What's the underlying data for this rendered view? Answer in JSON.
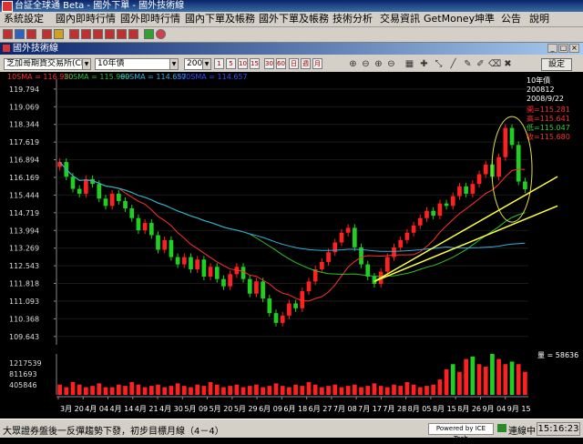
{
  "window": {
    "title": "台証全球通 Beta - 國外下單 - 國外技術線"
  },
  "menu": [
    "系統設定",
    "國內即時行情",
    "國外即時行情",
    "國內下單及帳務",
    "國外下單及帳務",
    "技術分析",
    "交易資訊",
    "GetMoney",
    "坤準",
    "公告",
    "說明"
  ],
  "inner_window": {
    "title": "國外技術線"
  },
  "chart_toolbar": {
    "exchange": "芝加哥期貨交易所(CME)",
    "product": "10年債",
    "period": "200812",
    "settings_label": "設定"
  },
  "chart_data": {
    "type": "candlestick",
    "title": "",
    "instrument": "10年債",
    "contract": "200812",
    "date": "2008/9/22",
    "ylim": [
      109.3,
      120.2
    ],
    "yticks": [
      119.794,
      119.069,
      118.344,
      117.619,
      116.894,
      116.169,
      115.444,
      114.719,
      113.994,
      113.269,
      112.543,
      111.818,
      111.093,
      110.368,
      109.643
    ],
    "xticks": [
      "3月 20",
      "4月 04",
      "4月 14",
      "4月 21",
      "4月 30",
      "5月 09",
      "5月 20",
      "5月 29",
      "6月 09",
      "6月 18",
      "6月 27",
      "7月 08",
      "7月 17",
      "7月 28",
      "8月 05",
      "8月 15",
      "8月 26",
      "9月 04",
      "9月 15"
    ],
    "ma_legend": [
      {
        "name": "10SMA",
        "value": "116.980",
        "color": "#ff3030"
      },
      {
        "name": "30SMA",
        "value": "115.999",
        "color": "#30c030"
      },
      {
        "name": "60SMA",
        "value": "114.657",
        "color": "#30b0e0"
      },
      {
        "name": "200SMA",
        "value": "114.657",
        "color": "#3050ff"
      }
    ],
    "ohlc_labels": [
      {
        "label": "開=115.281",
        "color": "#ff3030"
      },
      {
        "label": "高=115.641",
        "color": "#ff3030"
      },
      {
        "label": "低=115.047",
        "color": "#30d030"
      },
      {
        "label": "收=115.680",
        "color": "#ff3030"
      }
    ],
    "closes": [
      116.8,
      116.2,
      115.7,
      115.5,
      116.1,
      115.9,
      115.3,
      115.0,
      115.5,
      115.2,
      114.9,
      114.5,
      114.0,
      114.3,
      113.8,
      113.2,
      113.6,
      112.9,
      112.6,
      112.9,
      112.4,
      112.8,
      112.1,
      112.5,
      112.0,
      111.7,
      112.2,
      112.5,
      112.0,
      111.4,
      111.9,
      111.2,
      110.6,
      110.2,
      110.5,
      111.0,
      110.8,
      111.5,
      111.9,
      112.4,
      112.7,
      113.1,
      113.5,
      113.9,
      114.1,
      113.3,
      112.6,
      112.1,
      111.8,
      112.3,
      112.9,
      113.3,
      113.6,
      113.9,
      114.2,
      114.5,
      114.8,
      114.6,
      115.1,
      115.0,
      115.4,
      115.8,
      115.5,
      115.9,
      116.3,
      116.7,
      116.2,
      117.0,
      118.2,
      117.5,
      116.0,
      115.68
    ],
    "volume": {
      "label": "量",
      "last": "58636",
      "yticks": [
        1217539,
        811693,
        405846
      ],
      "values": [
        4000,
        3000,
        5000,
        4000,
        3000,
        3500,
        4500,
        3000,
        3000,
        4000,
        3500,
        5000,
        4000,
        3000,
        3500,
        4000,
        3000,
        3500,
        4500,
        3500,
        3000,
        4000,
        3500,
        5000,
        4000,
        3000,
        3500,
        4000,
        3000,
        3500,
        4000,
        3000,
        3500,
        4500,
        3500,
        3000,
        4000,
        3500,
        5000,
        4000,
        3000,
        3500,
        4000,
        3000,
        3500,
        4000,
        3000,
        3500,
        4500,
        3500,
        3000,
        4000,
        3500,
        5000,
        4000,
        3000,
        3500,
        4000,
        6000,
        10000,
        12000,
        9000,
        14000,
        15000,
        12000,
        11000,
        16000,
        14000,
        12000,
        13000,
        12000,
        9000
      ]
    }
  },
  "status": {
    "message": "大眾證券盤後一反彈趨勢下發，初步目標月線（4－4）",
    "powered": "Powered by ICE Tech",
    "connection": "連線中",
    "time": "15:16:23"
  }
}
